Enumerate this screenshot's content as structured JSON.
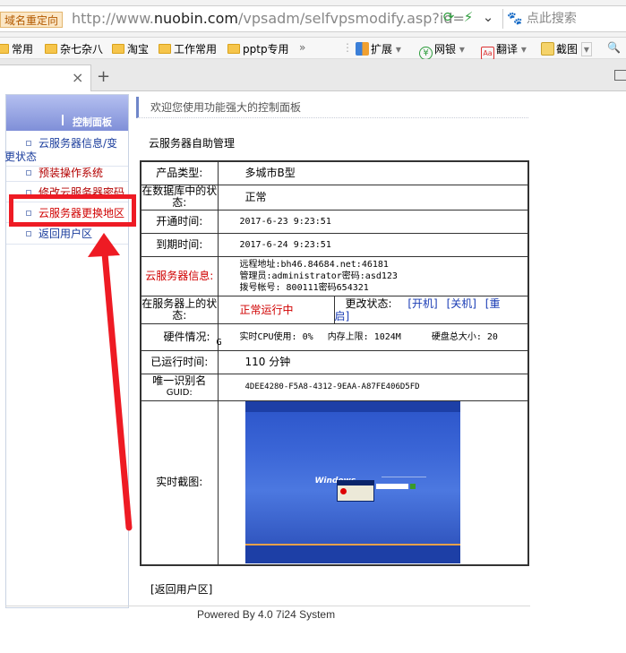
{
  "browser": {
    "redirect_tag": "域名重定向",
    "url_prefix": "http://www.",
    "url_domain": "nuobin.com",
    "url_path": "/vpsadm/selfvpsmodify.asp?id=",
    "search_placeholder": "点此搜索",
    "bookmarks": [
      {
        "label": "常用"
      },
      {
        "label": "杂七杂八"
      },
      {
        "label": "淘宝"
      },
      {
        "label": "工作常用"
      },
      {
        "label": "pptp专用"
      }
    ],
    "overflow_label": "»",
    "toolbar": {
      "extensions": "扩展",
      "banking": "网银",
      "translate": "翻译",
      "screenshot": "截图"
    },
    "tab_close": "×",
    "new_tab": "+"
  },
  "sidebar": {
    "title": "控制面板",
    "items": [
      {
        "label_line1": "云服务器信息/变",
        "label_line2": "更状态"
      },
      {
        "label": "预装操作系统"
      },
      {
        "label": "修改云服务器密码"
      },
      {
        "label": "云服务器更换地区"
      },
      {
        "label": "返回用户区"
      }
    ]
  },
  "content": {
    "welcome": "欢迎您使用功能强大的控制面板",
    "section_title": "云服务器自助管理",
    "rows": {
      "product_type": {
        "label": "产品类型:",
        "value": "多城市B型"
      },
      "db_status": {
        "label": "在数据库中的状态:",
        "value": "正常"
      },
      "open_time": {
        "label": "开通时间:",
        "value": "2017-6-23 9:23:51"
      },
      "expire_time": {
        "label": "到期时间:",
        "value": "2017-6-24 9:23:51"
      },
      "server_info": {
        "label": "云服务器信息:",
        "line1": "远程地址:bh46.84684.net:46181",
        "line2": "管理员:administrator密码:asd123",
        "line3": "拨号帐号: 800111密码654321"
      },
      "server_status": {
        "label": "在服务器上的状态:",
        "value": "正常运行中",
        "change_label": "更改状态:",
        "power_on": "[开机]",
        "power_off": "[关机]",
        "restart_part1": "[重",
        "restart_part2": "启]"
      },
      "hardware": {
        "label": "硬件情况:",
        "cpu": "实时CPU使用: 0%",
        "memory": "内存上限: 1024M",
        "disk": "硬盘总大小: 20",
        "disk_unit": "G"
      },
      "uptime": {
        "label": "已运行时间:",
        "value": "110 分钟"
      },
      "guid": {
        "label_line1": "唯一识别名",
        "label_line2": "GUID:",
        "value": "4DEE4280-F5A8-4312-9EAA-A87FE406D5FD"
      },
      "screenshot": {
        "label": "实时截图:",
        "os_title": "Windows"
      }
    },
    "back_link": "[返回用户区]"
  },
  "footer": "Powered By 4.0 7i24 System",
  "colors": {
    "sidebar_header": "#7f8fd8",
    "highlight": "#ee1b24",
    "status_red": "#d00000",
    "action_blue": "#1a3cb5"
  }
}
